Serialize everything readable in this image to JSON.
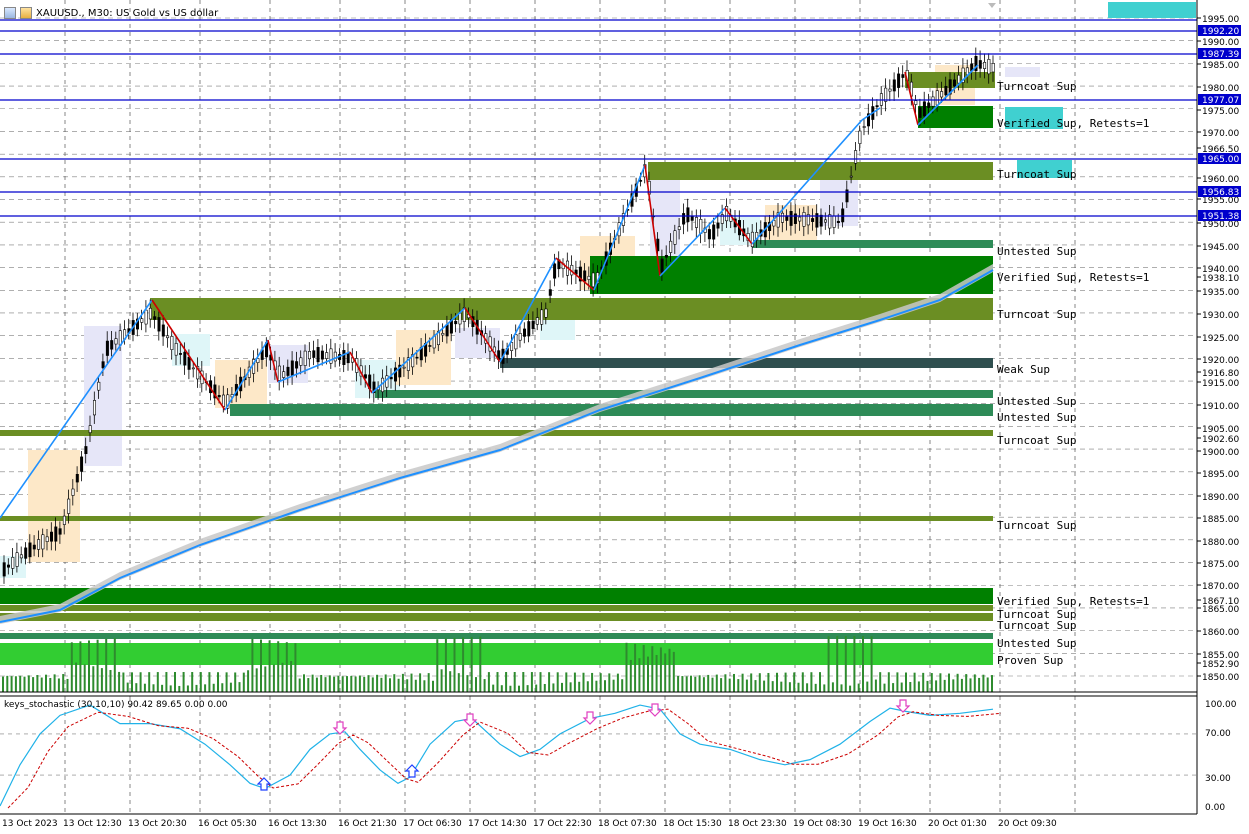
{
  "window": {
    "symbol_label": "XAUUSD., M30:  US Gold vs US dollar",
    "indicator_label": "keys_stochastic (30,10,10) 90.42 89.65 0.00 0.00"
  },
  "price_axis": {
    "ticks": [
      "1995.00",
      "1990.00",
      "1985.00",
      "1980.00",
      "1975.00",
      "1970.00",
      "1966.50",
      "1960.00",
      "1955.00",
      "1950.00",
      "1945.00",
      "1940.00",
      "1938.10",
      "1935.00",
      "1930.00",
      "1925.00",
      "1920.00",
      "1916.80",
      "1915.00",
      "1910.00",
      "1905.00",
      "1902.60",
      "1900.00",
      "1895.00",
      "1890.00",
      "1885.00",
      "1880.00",
      "1875.00",
      "1870.00",
      "1867.10",
      "1865.00",
      "1860.00",
      "1855.00",
      "1852.90",
      "1850.00"
    ],
    "highlighted": [
      {
        "label": "1992.20",
        "style": "blue"
      },
      {
        "label": "1987.39",
        "style": "blue"
      },
      {
        "label": "1977.07",
        "style": "blue"
      },
      {
        "label": "1965.00",
        "style": "blue"
      },
      {
        "label": "1956.83",
        "style": "blue"
      },
      {
        "label": "1951.38",
        "style": "blue"
      }
    ]
  },
  "indicator_axis": {
    "ticks": [
      "100.00",
      "70.00",
      "30.00",
      "0.00"
    ]
  },
  "time_axis": {
    "labels": [
      "13 Oct 2023",
      "13 Oct 12:30",
      "13 Oct 20:30",
      "16 Oct 05:30",
      "16 Oct 13:30",
      "16 Oct 21:30",
      "17 Oct 06:30",
      "17 Oct 14:30",
      "17 Oct 22:30",
      "18 Oct 07:30",
      "18 Oct 15:30",
      "18 Oct 23:30",
      "19 Oct 08:30",
      "19 Oct 16:30",
      "20 Oct 01:30",
      "20 Oct 09:30"
    ]
  },
  "zones": [
    {
      "label": "Turncoat Sup",
      "price": 1982.0,
      "type": "turncoat"
    },
    {
      "label": "Verified Sup, Retests=1",
      "price": 1973.0,
      "type": "verified"
    },
    {
      "label": "Turncoat Sup",
      "price": 1960.5,
      "type": "turncoat"
    },
    {
      "label": "Untested Sup",
      "price": 1945.3,
      "type": "untested"
    },
    {
      "label": "Verified Sup, Retests=1",
      "price": 1939.0,
      "type": "verified"
    },
    {
      "label": "Turncoat Sup",
      "price": 1930.5,
      "type": "turncoat"
    },
    {
      "label": "Weak Sup",
      "price": 1919.5,
      "type": "weak"
    },
    {
      "label": "Untested Sup",
      "price": 1912.5,
      "type": "untested"
    },
    {
      "label": "Untested Sup",
      "price": 1909.5,
      "type": "untested"
    },
    {
      "label": "Turncoat Sup",
      "price": 1904.0,
      "type": "turncoat"
    },
    {
      "label": "Turncoat Sup",
      "price": 1885.0,
      "type": "turncoat"
    },
    {
      "label": "Verified Sup, Retests=1",
      "price": 1868.0,
      "type": "verified"
    },
    {
      "label": "Turncoat Sup",
      "price": 1865.0,
      "type": "turncoat"
    },
    {
      "label": "Turncoat Sup",
      "price": 1862.8,
      "type": "turncoat"
    },
    {
      "label": "Untested Sup",
      "price": 1858.5,
      "type": "untested"
    },
    {
      "label": "Proven Sup",
      "price": 1854.0,
      "type": "proven"
    }
  ],
  "colors": {
    "background": "#ffffff",
    "grid": "#7f7f7f",
    "hline": "#0000cc",
    "turncoat": "#6b8e23",
    "verified": "#008000",
    "untested": "#2e8b57",
    "weak": "#2f4f4f",
    "proven": "#32cd32",
    "zigzag_up": "#1e90ff",
    "zigzag_down": "#cc0000",
    "ma": "#1e90ff",
    "ma_band": "#c8c8c8",
    "volume": "#2e8b2e",
    "stoch_main": "#20b2e8",
    "stoch_signal": "#cc0000",
    "arrow_down": "#e040c0",
    "arrow_up": "#1e40ff"
  }
}
